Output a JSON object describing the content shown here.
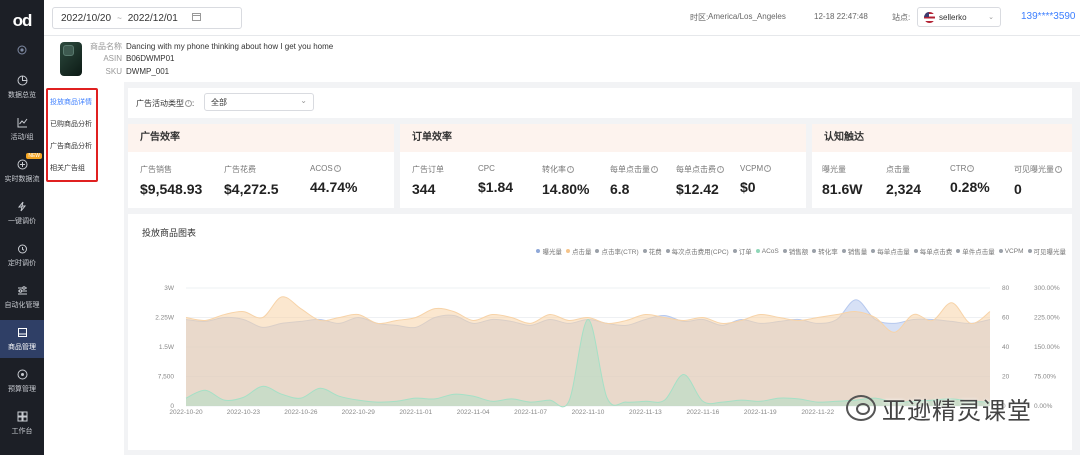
{
  "nav": {
    "logo": "od",
    "items": [
      {
        "label": "数据总览"
      },
      {
        "label": "活动/组"
      },
      {
        "label": "实时数据流",
        "badge": "NEW"
      },
      {
        "label": "一键调价"
      },
      {
        "label": "定时调价"
      },
      {
        "label": "自动化管理"
      },
      {
        "label": "商品管理"
      },
      {
        "label": "预算管理"
      },
      {
        "label": "工作台"
      }
    ]
  },
  "topbar": {
    "date_start": "2022/10/20",
    "date_end": "2022/12/01",
    "timezone_label": "时区:",
    "timezone_value": "America/Los_Angeles",
    "datetime": "12-18 22:47:48",
    "site_label": "站点:",
    "site_value": "sellerko",
    "user_phone": "139****3590"
  },
  "product": {
    "name_label": "商品名称",
    "name_value": "Dancing with my phone thinking about how I get you home",
    "asin_label": "ASIN",
    "asin_value": "B06DWMP01",
    "sku_label": "SKU",
    "sku_value": "DWMP_001"
  },
  "submenu": {
    "items": [
      {
        "label": "投放商品详情"
      },
      {
        "label": "已购商品分析"
      },
      {
        "label": "广告商品分析"
      },
      {
        "label": "相关广告组"
      }
    ]
  },
  "filter": {
    "label": "广告活动类型",
    "value": "全部"
  },
  "cards": {
    "ad_efficiency": {
      "title": "广告效率",
      "metrics": [
        {
          "label": "广告销售",
          "value": "$9,548.93"
        },
        {
          "label": "广告花费",
          "value": "$4,272.5"
        },
        {
          "label": "ACOS",
          "value": "44.74%"
        }
      ]
    },
    "order_efficiency": {
      "title": "订单效率",
      "metrics": [
        {
          "label": "广告订单",
          "value": "344"
        },
        {
          "label": "CPC",
          "value": "$1.84"
        },
        {
          "label": "转化率",
          "value": "14.80%"
        },
        {
          "label": "每单点击量",
          "value": "6.8"
        },
        {
          "label": "每单点击费",
          "value": "$12.42"
        },
        {
          "label": "VCPM",
          "value": "$0"
        }
      ]
    },
    "awareness": {
      "title": "认知触达",
      "metrics": [
        {
          "label": "曝光量",
          "value": "81.6W"
        },
        {
          "label": "点击量",
          "value": "2,324"
        },
        {
          "label": "CTR",
          "value": "0.28%"
        },
        {
          "label": "可见曝光量",
          "value": "0"
        }
      ]
    }
  },
  "chart": {
    "title": "投放商品图表",
    "legend": [
      {
        "name": "曝光量",
        "color": "#8fa8d8"
      },
      {
        "name": "点击量",
        "color": "#f5c48a"
      },
      {
        "name": "点击率(CTR)",
        "color": "#9aa0a8"
      },
      {
        "name": "花费",
        "color": "#9aa0a8"
      },
      {
        "name": "每次点击费用(CPC)",
        "color": "#9aa0a8"
      },
      {
        "name": "订单",
        "color": "#9aa0a8"
      },
      {
        "name": "ACoS",
        "color": "#8fd6b8"
      },
      {
        "name": "销售额",
        "color": "#9aa0a8"
      },
      {
        "name": "转化率",
        "color": "#9aa0a8"
      },
      {
        "name": "销售量",
        "color": "#9aa0a8"
      },
      {
        "name": "每单点击量",
        "color": "#9aa0a8"
      },
      {
        "name": "每单点击费",
        "color": "#9aa0a8"
      },
      {
        "name": "单件点击量",
        "color": "#9aa0a8"
      },
      {
        "name": "VCPM",
        "color": "#9aa0a8"
      },
      {
        "name": "可见曝光量",
        "color": "#9aa0a8"
      }
    ]
  },
  "chart_data": {
    "type": "area",
    "x": [
      "2022-10-20",
      "2022-10-21",
      "2022-10-22",
      "2022-10-23",
      "2022-10-24",
      "2022-10-25",
      "2022-10-26",
      "2022-10-27",
      "2022-10-28",
      "2022-10-29",
      "2022-10-30",
      "2022-10-31",
      "2022-11-01",
      "2022-11-02",
      "2022-11-03",
      "2022-11-04",
      "2022-11-05",
      "2022-11-06",
      "2022-11-07",
      "2022-11-08",
      "2022-11-09",
      "2022-11-10",
      "2022-11-11",
      "2022-11-12",
      "2022-11-13",
      "2022-11-14",
      "2022-11-15",
      "2022-11-16",
      "2022-11-17",
      "2022-11-18",
      "2022-11-19",
      "2022-11-20",
      "2022-11-21",
      "2022-11-22",
      "2022-11-23",
      "2022-11-24",
      "2022-11-25",
      "2022-11-26",
      "2022-11-27",
      "2022-11-28",
      "2022-11-29",
      "2022-11-30",
      "2022-12-01"
    ],
    "x_tick_labels": [
      "2022-10-20",
      "2022-10-23",
      "2022-10-26",
      "2022-10-29",
      "2022-11-01",
      "2022-11-04",
      "2022-11-07",
      "2022-11-10",
      "2022-11-13",
      "2022-11-16",
      "2022-11-19",
      "2022-11-22"
    ],
    "y_left": {
      "ticks": [
        "0",
        "7,500",
        "1.5W",
        "2.25W",
        "3W"
      ],
      "range": [
        0,
        30000
      ]
    },
    "y_mid": {
      "ticks": [
        "0",
        "20",
        "40",
        "60",
        "80"
      ],
      "range": [
        0,
        80
      ]
    },
    "y_right": {
      "ticks": [
        "0.00%",
        "75.00%",
        "150.00%",
        "225.00%",
        "300.00%"
      ],
      "range": [
        0,
        300
      ]
    },
    "series": [
      {
        "name": "曝光量",
        "axis": "left",
        "color": "#b7c9ee",
        "values": [
          22000,
          21500,
          22500,
          22000,
          20000,
          21000,
          21500,
          22000,
          21000,
          22500,
          21000,
          20500,
          20000,
          22500,
          23000,
          21000,
          22000,
          21500,
          20500,
          22000,
          21000,
          22000,
          21000,
          20500,
          22000,
          23000,
          21500,
          22000,
          20500,
          22000,
          21000,
          21500,
          22000,
          21000,
          22000,
          27000,
          22000,
          21000,
          22000,
          22000,
          21500,
          21000,
          22000
        ]
      },
      {
        "name": "点击量",
        "axis": "mid",
        "color": "#f7d3a8",
        "values": [
          60,
          58,
          62,
          64,
          60,
          74,
          66,
          58,
          60,
          62,
          56,
          58,
          60,
          66,
          64,
          58,
          62,
          60,
          56,
          62,
          58,
          60,
          56,
          58,
          62,
          60,
          58,
          60,
          56,
          58,
          62,
          60,
          58,
          60,
          62,
          64,
          60,
          50,
          62,
          58,
          70,
          56,
          64
        ]
      },
      {
        "name": "ACoS",
        "axis": "right",
        "color": "#a5e0c6",
        "values": [
          20,
          40,
          15,
          22,
          50,
          30,
          20,
          45,
          25,
          15,
          10,
          12,
          20,
          18,
          30,
          25,
          12,
          18,
          10,
          15,
          12,
          220,
          20,
          10,
          12,
          15,
          80,
          12,
          10,
          15,
          12,
          20,
          18,
          10,
          12,
          15,
          20,
          10,
          12,
          15,
          18,
          12,
          10
        ]
      }
    ]
  }
}
